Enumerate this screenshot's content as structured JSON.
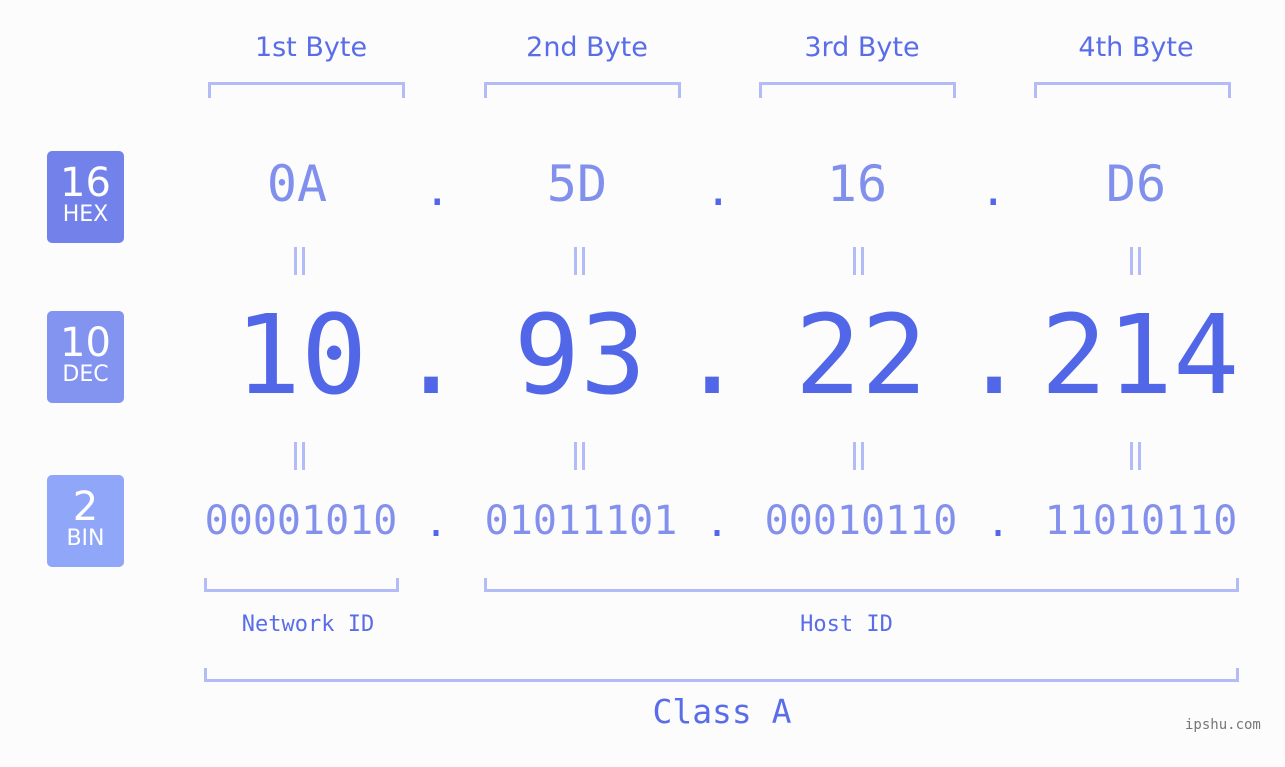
{
  "byte_headers": [
    "1st Byte",
    "2nd Byte",
    "3rd Byte",
    "4th Byte"
  ],
  "badges": [
    {
      "num": "16",
      "label": "HEX",
      "color": "#7282ea"
    },
    {
      "num": "10",
      "label": "DEC",
      "color": "#8393f0"
    },
    {
      "num": "2",
      "label": "BIN",
      "color": "#90a6f8"
    }
  ],
  "hex": [
    "0A",
    "5D",
    "16",
    "D6"
  ],
  "dec": [
    "10",
    "93",
    "22",
    "214"
  ],
  "bin": [
    "00001010",
    "01011101",
    "00010110",
    "11010110"
  ],
  "separator": ".",
  "network_id_label": "Network ID",
  "host_id_label": "Host ID",
  "class_label": "Class A",
  "watermark": "ipshu.com"
}
